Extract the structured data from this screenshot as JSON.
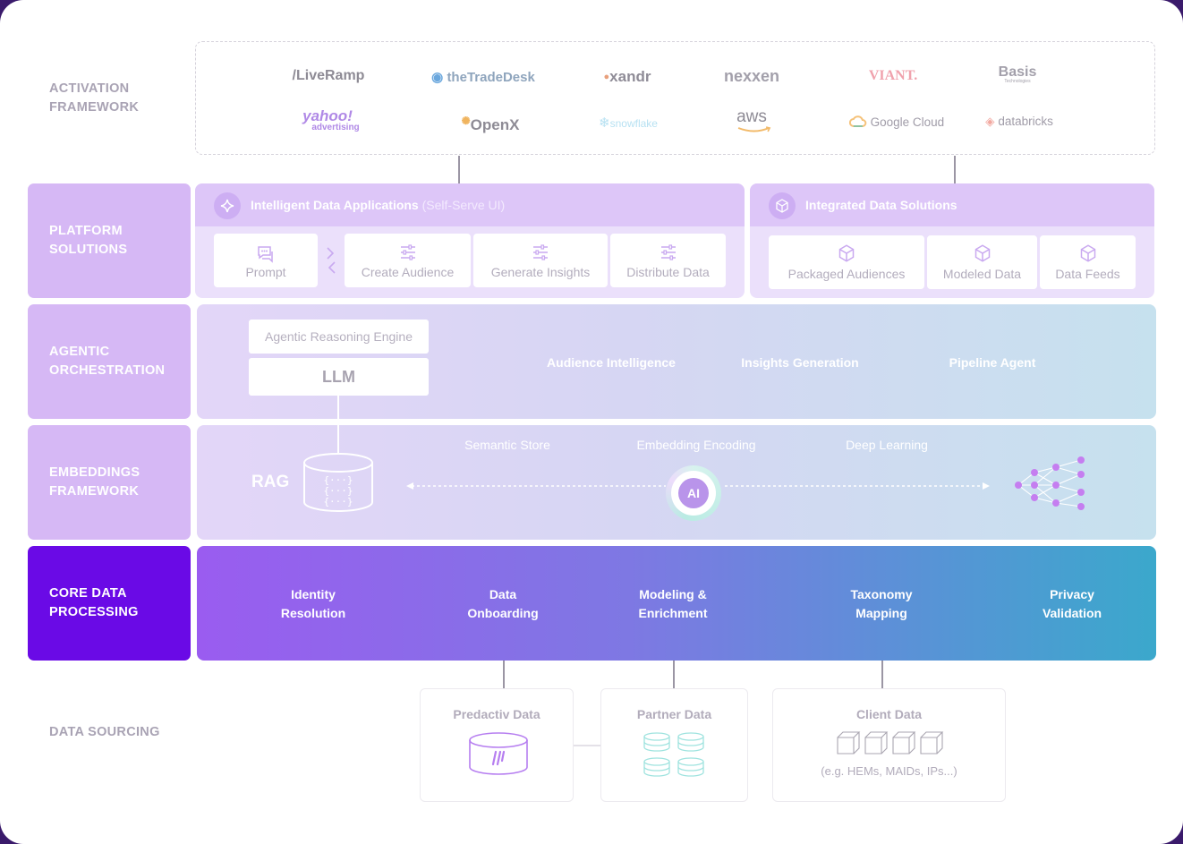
{
  "layers": {
    "activation": "ACTIVATION\nFRAMEWORK",
    "platform": "PLATFORM\nSOLUTIONS",
    "agentic": "AGENTIC\nORCHESTRATION",
    "embeddings": "EMBEDDINGS\nFRAMEWORK",
    "core": "CORE DATA\nPROCESSING",
    "sourcing": "DATA SOURCING"
  },
  "partners": {
    "liveramp": "/LiveRamp",
    "tradedesk": "theTradeDesk",
    "xandr": "xandr",
    "nexxen": "nexxen",
    "viant": "VIANT.",
    "basis": "Basis",
    "basis_sub": "Technologies",
    "yahoo": "yahoo!",
    "yahoo_sub": "advertising",
    "openx": "OpenX",
    "snowflake": "snowflake",
    "aws": "aws",
    "googlecloud": "Google Cloud",
    "databricks": "databricks"
  },
  "platform": {
    "apps_title": "Intelligent Data Applications",
    "apps_sub": "(Self-Serve UI)",
    "apps_cards": [
      "Prompt",
      "Create Audience",
      "Generate Insights",
      "Distribute Data"
    ],
    "solutions_title": "Integrated Data Solutions",
    "solutions_cards": [
      "Packaged Audiences",
      "Modeled Data",
      "Data Feeds"
    ]
  },
  "agentic": {
    "engine": "Agentic Reasoning Engine",
    "llm": "LLM",
    "agents": [
      "Audience Intelligence",
      "Insights Generation",
      "Pipeline Agent"
    ]
  },
  "embeddings": {
    "rag": "RAG",
    "stages": [
      "Semantic Store",
      "Embedding Encoding",
      "Deep Learning"
    ],
    "ai": "AI"
  },
  "core": {
    "steps": [
      "Identity\nResolution",
      "Data\nOnboarding",
      "Modeling &\nEnrichment",
      "Taxonomy\nMapping",
      "Privacy\nValidation"
    ]
  },
  "sources": {
    "predactiv": "Predactiv Data",
    "partner": "Partner Data",
    "client": "Client Data",
    "client_note": "(e.g. HEMs, MAIDs, IPs...)"
  },
  "colors": {
    "frame": "#3a1a6b",
    "layer_soft": "#d6b8f5",
    "layer_core": "#6a0ae6",
    "core_gradient_start": "#9a5cf0",
    "core_gradient_end": "#3ba8cc"
  }
}
